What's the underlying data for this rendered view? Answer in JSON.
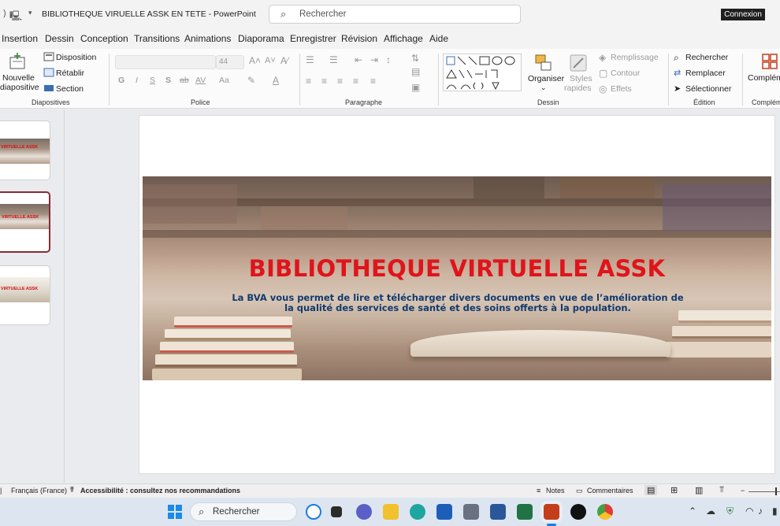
{
  "titlebar": {
    "doc_title": "BIBLIOTHEQUE VIRUELLE ASSK EN TETE  -  PowerPoint",
    "search_placeholder": "Rechercher",
    "signin_label": "Connexion"
  },
  "menu": {
    "tabs": [
      "Insertion",
      "Dessin",
      "Conception",
      "Transitions",
      "Animations",
      "Diaporama",
      "Enregistrer",
      "Révision",
      "Affichage",
      "Aide"
    ]
  },
  "ribbon": {
    "slides_group": {
      "new_slide_line1": "Nouvelle",
      "new_slide_line2": "diapositive",
      "layout": "Disposition",
      "reset": "Rétablir",
      "section": "Section",
      "label": "Diapositives"
    },
    "font_group": {
      "font_size": "44",
      "bold": "G",
      "italic": "I",
      "underline": "S",
      "shadow": "S",
      "strike": "ab",
      "spacing": "AV",
      "case": "Aa",
      "label": "Police"
    },
    "paragraph_group": {
      "label": "Paragraphe"
    },
    "drawing_group": {
      "arrange": "Organiser",
      "quick_styles_line1": "Styles",
      "quick_styles_line2": "rapides",
      "fill": "Remplissage",
      "outline": "Contour",
      "effects": "Effets",
      "label": "Dessin"
    },
    "editing_group": {
      "find": "Rechercher",
      "replace": "Remplacer",
      "select": "Sélectionner",
      "label": "Édition"
    },
    "addins_group": {
      "button": "Complém",
      "label": "Complém"
    }
  },
  "thumbnails": [
    {
      "text": "VIRTUELLE ASSK"
    },
    {
      "text": "VIRTUELLE ASSK"
    },
    {
      "text": "VIRTUELLE ASSK"
    }
  ],
  "slide": {
    "title": "BIBLIOTHEQUE VIRTUELLE ASSK",
    "subtitle_line1": "La BVA vous permet de lire et télécharger divers documents en vue de l’amélioration de",
    "subtitle_line2": "la qualité des services de santé et des soins offerts à la population."
  },
  "statusbar": {
    "language": "Français (France)",
    "accessibility": "Accessibilité : consultez nos recommandations",
    "notes": "Notes",
    "comments": "Commentaires"
  },
  "taskbar": {
    "search_placeholder": "Rechercher"
  },
  "colors": {
    "title_red": "#e0141b",
    "subtitle_blue": "#123a6e",
    "selected_thumb_border": "#8a2b33",
    "powerpoint_orange": "#c43e1c"
  }
}
